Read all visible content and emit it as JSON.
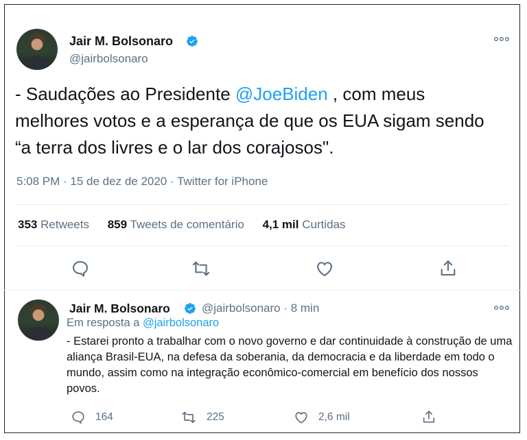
{
  "tweet": {
    "author_name": "Jair M. Bolsonaro",
    "author_handle": "@jairbolsonaro",
    "text_before": "- Saudações ao Presidente ",
    "mention": "@JoeBiden",
    "text_after": " , com meus melhores votos e a esperança de que os EUA sigam sendo “a terra dos livres e o lar dos corajosos\".",
    "timestamp": "5:08 PM · 15 de dez de 2020 · Twitter for iPhone",
    "stats": {
      "retweets_count": "353",
      "retweets_label": "Retweets",
      "quotes_count": "859",
      "quotes_label": "Tweets de comentário",
      "likes_count": "4,1 mil",
      "likes_label": "Curtidas"
    },
    "more_icon": "more-dots-icon"
  },
  "reply": {
    "author_name": "Jair M. Bolsonaro",
    "handle_time": "@jairbolsonaro · 8 min",
    "in_reply_prefix": "Em resposta a ",
    "in_reply_handle": "@jairbolsonaro",
    "text": "- Estarei pronto a trabalhar com o novo governo e dar continuidade à construção de uma aliança Brasil-EUA, na defesa da soberania, da democracia e da liberdade em todo o mundo, assim como na integração econômico-comercial em benefício dos nossos povos.",
    "replies_count": "164",
    "retweets_count": "225",
    "likes_count": "2,6 mil"
  },
  "colors": {
    "accent": "#1da1f2",
    "secondary_text": "#5b7083",
    "text": "#0f1419",
    "divider": "#e6ecf0"
  }
}
